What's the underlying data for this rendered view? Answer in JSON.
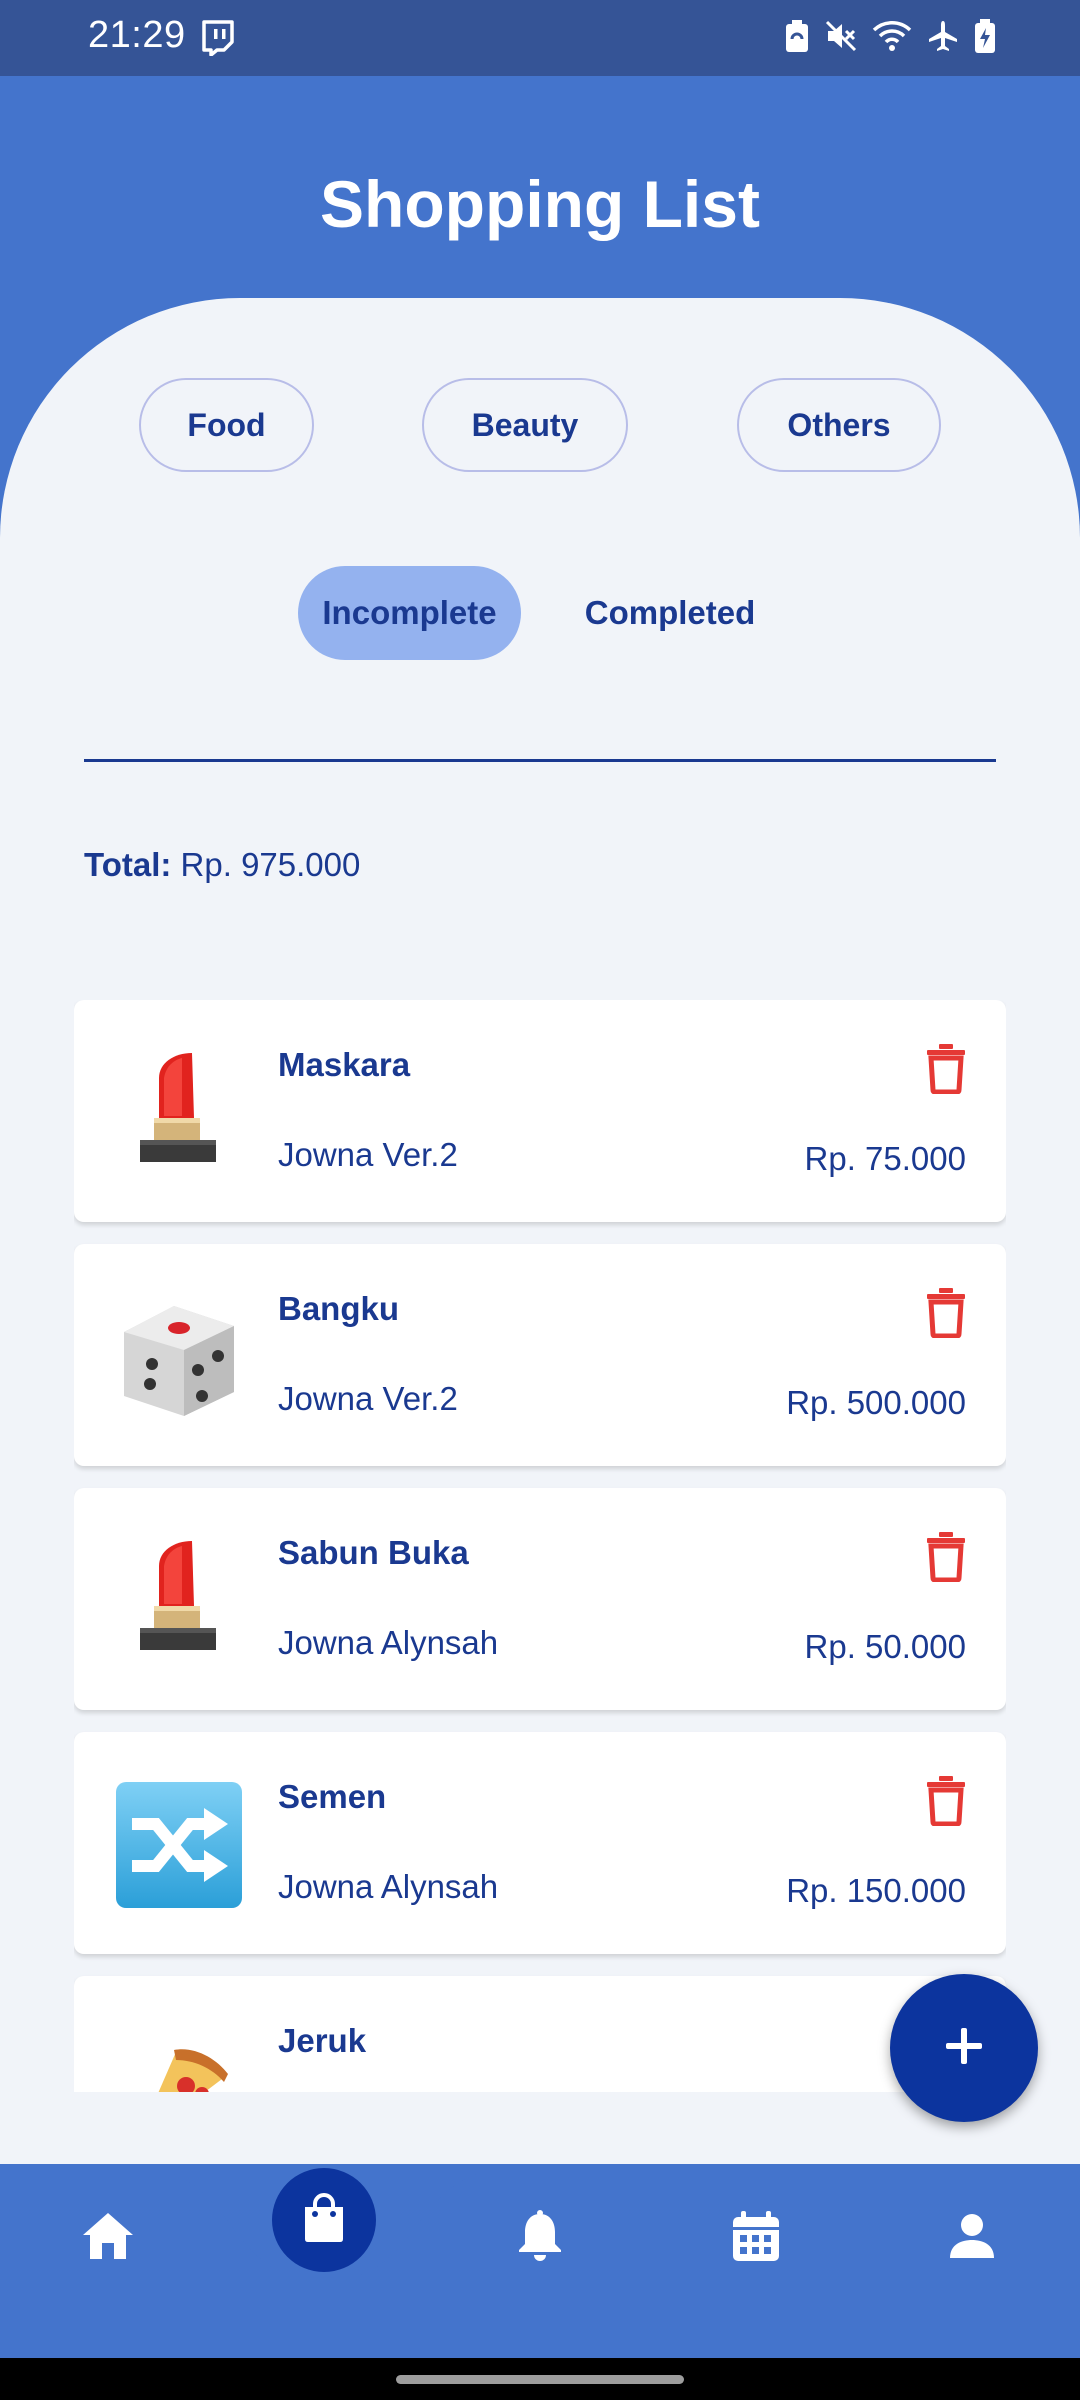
{
  "status_bar": {
    "time": "21:29",
    "left_icon": "twitch-icon",
    "icons": [
      "battery-saver-icon",
      "mute-icon",
      "wifi-icon",
      "airplane-icon",
      "battery-charging-icon"
    ]
  },
  "header": {
    "title": "Shopping List"
  },
  "categories": [
    "Food",
    "Beauty",
    "Others"
  ],
  "status_tabs": {
    "incomplete": "Incomplete",
    "completed": "Completed",
    "active": "Incomplete"
  },
  "total": {
    "label": "Total:",
    "value": "Rp. 975.000"
  },
  "items": [
    {
      "name": "Maskara",
      "subtitle": "Jowna Ver.2",
      "price": "Rp. 75.000",
      "icon": "lipstick-icon"
    },
    {
      "name": "Bangku",
      "subtitle": "Jowna Ver.2",
      "price": "Rp. 500.000",
      "icon": "dice-icon"
    },
    {
      "name": "Sabun Buka",
      "subtitle": "Jowna Alynsah",
      "price": "Rp. 50.000",
      "icon": "lipstick-icon"
    },
    {
      "name": "Semen",
      "subtitle": "Jowna Alynsah",
      "price": "Rp. 150.000",
      "icon": "shuffle-icon"
    },
    {
      "name": "Jeruk",
      "subtitle": "",
      "price": "",
      "icon": "pizza-icon"
    }
  ],
  "fab": {
    "icon": "plus-icon"
  },
  "bottom_nav": {
    "items": [
      "home-icon",
      "shopping-bag-icon",
      "bell-icon",
      "calendar-icon",
      "profile-icon"
    ],
    "active": "shopping-bag-icon"
  },
  "colors": {
    "primary": "#4474cc",
    "status_bar": "#355496",
    "dark_blue": "#0c349e",
    "text_blue": "#1a3990",
    "background": "#f1f4f9",
    "active_tab": "#94b2ef",
    "delete_red": "#e53935"
  }
}
